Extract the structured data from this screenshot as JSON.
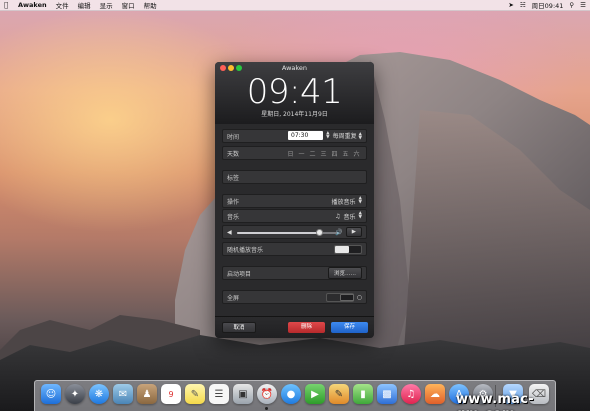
{
  "menubar": {
    "app_name": "Awaken",
    "items": [
      "文件",
      "编辑",
      "显示",
      "窗口",
      "帮助"
    ],
    "clock": "周日09:41"
  },
  "window": {
    "title": "Awaken",
    "time_display": "09:41",
    "date_display": "星期日, 2014年11月9日"
  },
  "alarm": {
    "time_label": "时间",
    "time_value": "07:30",
    "repeat_value": "每周重复",
    "days_label": "天数",
    "days": [
      "日",
      "一",
      "二",
      "三",
      "四",
      "五",
      "六"
    ],
    "tag_label": "标签",
    "action_label": "操作",
    "action_value": "播放音乐",
    "music_label": "音乐",
    "music_value": "音乐",
    "volume": 0.82,
    "shuffle_label": "随机播放音乐",
    "launch_label": "启动项目",
    "browse_label": "浏览……",
    "fullscreen_label": "全屏"
  },
  "buttons": {
    "cancel": "取消",
    "delete": "删除",
    "save": "保存"
  },
  "watermark": "www.mac-gm.com",
  "colors": {
    "delete_red": "#d9393b",
    "save_blue": "#2f77e0"
  }
}
